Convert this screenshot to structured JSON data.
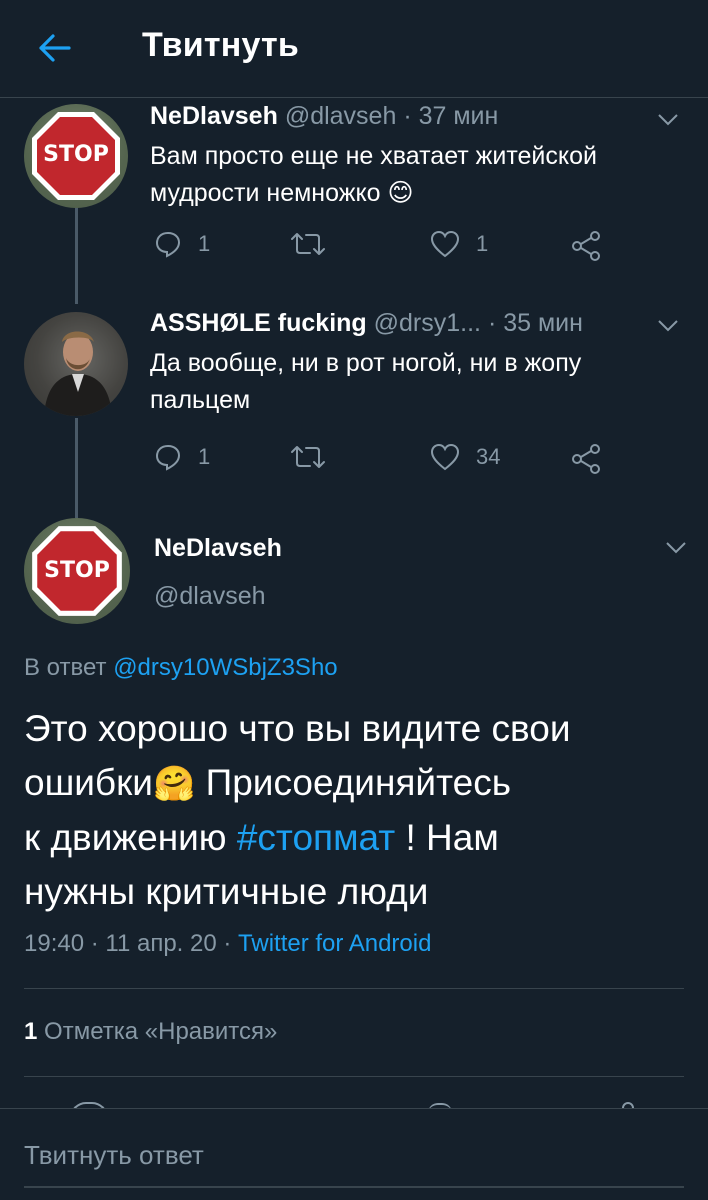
{
  "header": {
    "title": "Твитнуть"
  },
  "tweets": [
    {
      "name": "NeDlavseh",
      "handle": "@dlavseh",
      "time": "· 37 мин",
      "text_line1": "Вам просто еще не хватает житейской",
      "text_line2": "мудрости немножко",
      "emoji": "😊",
      "replies": "1",
      "likes": "1"
    },
    {
      "name": "ASSHØLE fucking",
      "handle": "@drsy1...",
      "time": "· 35 мин",
      "text_line1": "Да вообще, ни в рот ногой, ни в жопу",
      "text_line2": "пальцем",
      "replies": "1",
      "likes": "34"
    }
  ],
  "main_tweet": {
    "name": "NeDlavseh",
    "handle": "@dlavseh",
    "reply_prefix": "В ответ",
    "reply_to": "@drsy10WSbjZ3Sho",
    "line1": "Это хорошо что вы видите свои",
    "line2_a": "ошибки",
    "emoji": "🤗",
    "line2_b": " Присоединяйтесь",
    "line3_a": "к движению ",
    "hashtag": "#стопмат",
    "line3_b": " ! Нам",
    "line4": "нужны критичные люди",
    "timestamp": "19:40 · 11 апр. 20 · ",
    "source": "Twitter for Android",
    "likes_count": "1",
    "likes_label": "Отметка «Нравится»"
  },
  "stop_sign_text": "STOP",
  "reply_box": {
    "placeholder": "Твитнуть ответ"
  },
  "colors": {
    "background": "#15202b",
    "accent": "#1da1f2",
    "secondary_text": "#8899a6",
    "divider": "#38444d"
  }
}
